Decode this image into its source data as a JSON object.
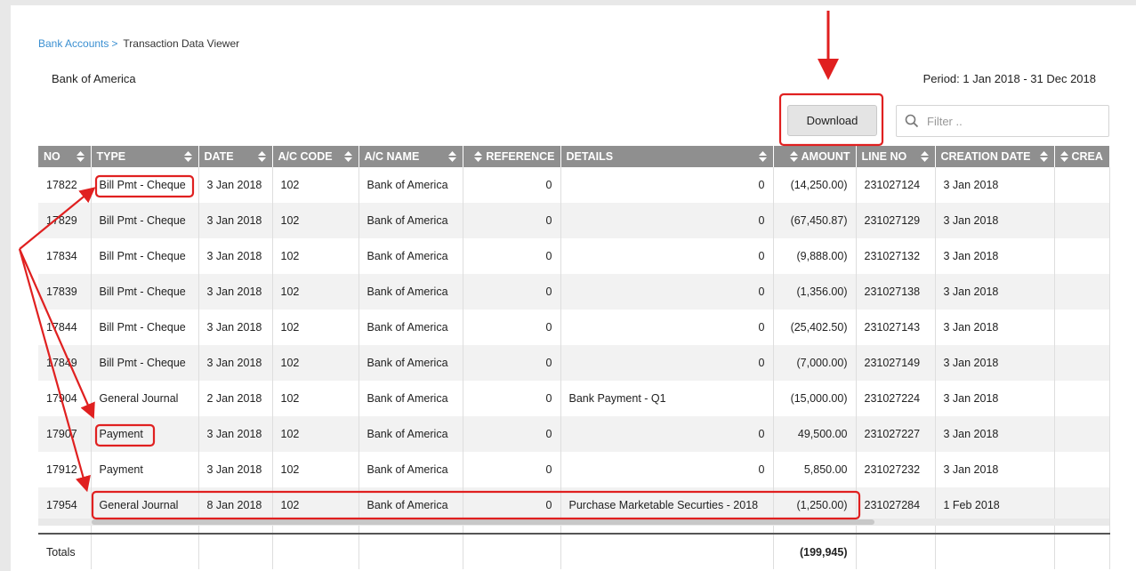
{
  "breadcrumb": {
    "parent": "Bank Accounts",
    "separator": ">",
    "current": "Transaction Data Viewer"
  },
  "account": {
    "bank_name": "Bank of America",
    "period": "Period: 1 Jan 2018 - 31 Dec 2018"
  },
  "toolbar": {
    "download_label": "Download",
    "filter_placeholder": "Filter .."
  },
  "table": {
    "columns": [
      "NO",
      "TYPE",
      "DATE",
      "A/C CODE",
      "A/C NAME",
      "REFERENCE",
      "DETAILS",
      "AMOUNT",
      "LINE NO",
      "CREATION DATE",
      "CREA"
    ],
    "rows": [
      {
        "no": "17822",
        "type": "Bill Pmt - Cheque",
        "date": "3 Jan 2018",
        "code": "102",
        "name": "Bank of America",
        "ref": "0",
        "details": "0",
        "amount": "(14,250.00)",
        "line": "231027124",
        "created": "3 Jan 2018"
      },
      {
        "no": "17829",
        "type": "Bill Pmt - Cheque",
        "date": "3 Jan 2018",
        "code": "102",
        "name": "Bank of America",
        "ref": "0",
        "details": "0",
        "amount": "(67,450.87)",
        "line": "231027129",
        "created": "3 Jan 2018"
      },
      {
        "no": "17834",
        "type": "Bill Pmt - Cheque",
        "date": "3 Jan 2018",
        "code": "102",
        "name": "Bank of America",
        "ref": "0",
        "details": "0",
        "amount": "(9,888.00)",
        "line": "231027132",
        "created": "3 Jan 2018"
      },
      {
        "no": "17839",
        "type": "Bill Pmt - Cheque",
        "date": "3 Jan 2018",
        "code": "102",
        "name": "Bank of America",
        "ref": "0",
        "details": "0",
        "amount": "(1,356.00)",
        "line": "231027138",
        "created": "3 Jan 2018"
      },
      {
        "no": "17844",
        "type": "Bill Pmt - Cheque",
        "date": "3 Jan 2018",
        "code": "102",
        "name": "Bank of America",
        "ref": "0",
        "details": "0",
        "amount": "(25,402.50)",
        "line": "231027143",
        "created": "3 Jan 2018"
      },
      {
        "no": "17849",
        "type": "Bill Pmt - Cheque",
        "date": "3 Jan 2018",
        "code": "102",
        "name": "Bank of America",
        "ref": "0",
        "details": "0",
        "amount": "(7,000.00)",
        "line": "231027149",
        "created": "3 Jan 2018"
      },
      {
        "no": "17904",
        "type": "General Journal",
        "date": "2 Jan 2018",
        "code": "102",
        "name": "Bank of America",
        "ref": "0",
        "details": "Bank Payment - Q1",
        "amount": "(15,000.00)",
        "line": "231027224",
        "created": "3 Jan 2018"
      },
      {
        "no": "17907",
        "type": "Payment",
        "date": "3 Jan 2018",
        "code": "102",
        "name": "Bank of America",
        "ref": "0",
        "details": "0",
        "amount": "49,500.00",
        "line": "231027227",
        "created": "3 Jan 2018"
      },
      {
        "no": "17912",
        "type": "Payment",
        "date": "3 Jan 2018",
        "code": "102",
        "name": "Bank of America",
        "ref": "0",
        "details": "0",
        "amount": "5,850.00",
        "line": "231027232",
        "created": "3 Jan 2018"
      },
      {
        "no": "17954",
        "type": "General Journal",
        "date": "8 Jan 2018",
        "code": "102",
        "name": "Bank of America",
        "ref": "0",
        "details": "Purchase Marketable Securties - 2018",
        "amount": "(1,250.00)",
        "line": "231027284",
        "created": "1 Feb 2018"
      }
    ],
    "totals": {
      "label": "Totals",
      "amount": "(199,945)"
    }
  },
  "colors": {
    "header_bg": "#8f8f8f",
    "link": "#3a8fd1",
    "annotation": "#e02020",
    "alt_row": "#f2f2f2"
  },
  "icons": {
    "filter": "search-icon",
    "sort": "sort-icon"
  }
}
